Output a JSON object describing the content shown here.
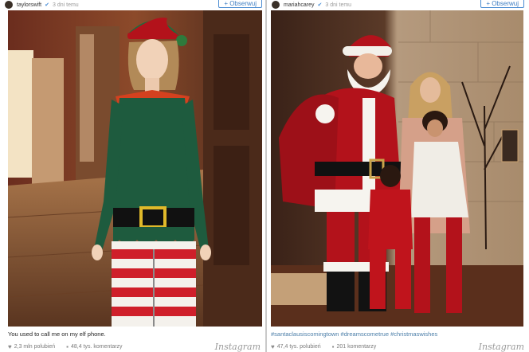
{
  "posts": [
    {
      "username": "taylorswift",
      "time": "3 dni temu",
      "follow_label": "+ Obserwuj",
      "caption": "You used to call me on my elf phone.",
      "likes": "2,3 mln polubień",
      "comments": "48,4 tys. komentarzy",
      "brand": "Instagram"
    },
    {
      "username": "mariahcarey",
      "time": "3 dni temu",
      "follow_label": "+ Obserwuj",
      "caption": "#santaclausiscomingtown #dreamscometrue #christmaswishes",
      "likes": "47,4 tys. polubień",
      "comments": "201 komentarzy",
      "brand": "Instagram"
    }
  ],
  "icons": {
    "verified": "verified-badge-icon",
    "like": "heart-icon",
    "comment": "speech-bubble-icon"
  },
  "colors": {
    "follow_border": "#4a8bd1",
    "hashtag": "#4b7ea8",
    "elf_green": "#1e5b3e",
    "santa_red": "#b3121b"
  }
}
